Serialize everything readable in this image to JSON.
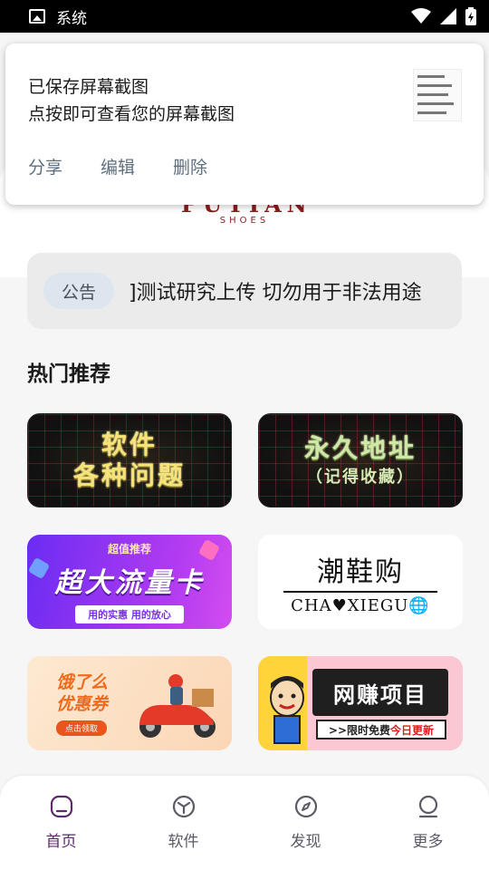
{
  "status_bar": {
    "app_title": "系统"
  },
  "toast": {
    "line1": "已保存屏幕截图",
    "line2": "点按即可查看您的屏幕截图",
    "actions": [
      "分享",
      "编辑",
      "删除"
    ]
  },
  "logo": {
    "main": "PUTIAN",
    "sub": "SHOES"
  },
  "notice": {
    "tag": "公告",
    "text": "]测试研究上传 切勿用于非法用途"
  },
  "section": {
    "title": "热门推荐"
  },
  "tiles": {
    "t1": {
      "line1": "软件",
      "line2": "各种问题"
    },
    "t2": {
      "line1": "永久地址",
      "line2": "（记得收藏）"
    },
    "t3": {
      "top": "超值推荐",
      "big": "超大流量卡",
      "btn": "用的实惠 用的放心"
    },
    "t4": {
      "cn": "潮鞋购",
      "en": "CHA♥XIEGU🌐"
    },
    "t5": {
      "line1": "饿了么",
      "line2": "优惠券",
      "btn": "点击领取"
    },
    "t6": {
      "title": "网赚项目",
      "sub_prefix": ">>限时免费",
      "sub_red": "今日更新"
    }
  },
  "bottom_nav": [
    {
      "label": "首页",
      "icon": "home-icon",
      "active": true
    },
    {
      "label": "软件",
      "icon": "cube-icon",
      "active": false
    },
    {
      "label": "发现",
      "icon": "compass-icon",
      "active": false
    },
    {
      "label": "更多",
      "icon": "person-icon",
      "active": false
    }
  ],
  "colors": {
    "accent": "#5e2a6b",
    "toast_action": "#5d6e7e",
    "notice_tag_bg": "#dde6ef"
  }
}
